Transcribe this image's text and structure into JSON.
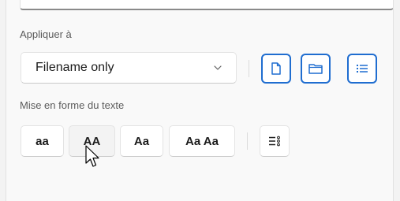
{
  "apply_section": {
    "label": "Appliquer à",
    "dropdown_value": "Filename only",
    "toggle_buttons": [
      {
        "icon": "file-icon"
      },
      {
        "icon": "folder-icon"
      },
      {
        "icon": "list-icon"
      }
    ]
  },
  "text_format_section": {
    "label": "Mise en forme du texte",
    "case_buttons": [
      "aa",
      "AA",
      "Aa",
      "Aa Aa"
    ],
    "extra_icon": "enumerate-icon"
  },
  "colors": {
    "accent": "#1f6dd0",
    "panel_bg": "#f9f9f9",
    "label_text": "#5b5b5b"
  }
}
